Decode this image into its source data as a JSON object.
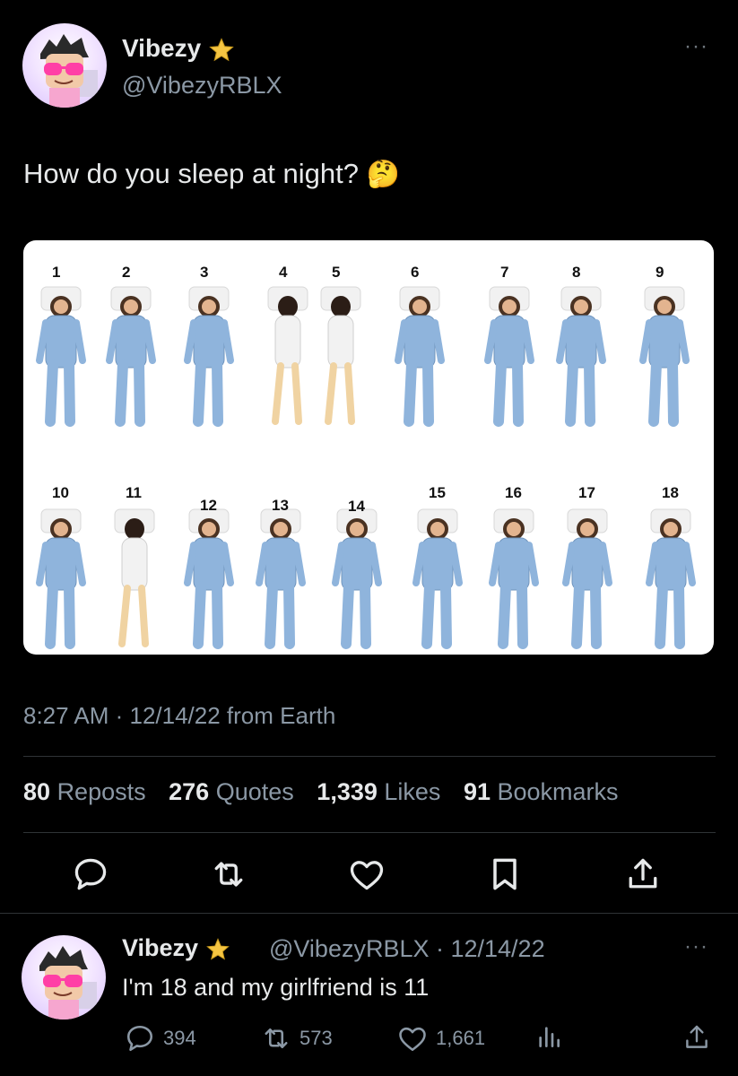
{
  "tweet": {
    "author_name": "Vibezy",
    "author_handle": "@VibezyRBLX",
    "more_label": "···",
    "text": "How do you sleep at night?",
    "emoji": "🤔",
    "timestamp": "8:27 AM · 12/14/22 from Earth",
    "stats": {
      "reposts_count": "80",
      "reposts_label": "Reposts",
      "quotes_count": "276",
      "quotes_label": "Quotes",
      "likes_count": "1,339",
      "likes_label": "Likes",
      "bookmarks_count": "91",
      "bookmarks_label": "Bookmarks"
    },
    "image": {
      "row1_labels": [
        "1",
        "2",
        "3",
        "4",
        "5",
        "6",
        "7",
        "8",
        "9"
      ],
      "row2_labels": [
        "10",
        "11",
        "12",
        "13",
        "14",
        "15",
        "16",
        "17",
        "18"
      ]
    }
  },
  "reply": {
    "author_name": "Vibezy",
    "meta": "@VibezyRBLX · 12/14/22",
    "more_label": "···",
    "text": "I'm 18 and my girlfriend is 11",
    "replies": "394",
    "reposts": "573",
    "likes": "1,661"
  },
  "colors": {
    "background": "#000000",
    "text": "#e7e9ea",
    "secondary": "#8b98a5",
    "divider": "#2f3336",
    "verified_star": "#f5c542",
    "pajama_blue": "#8fb4dc"
  },
  "icons": [
    "reply-icon",
    "repost-icon",
    "like-icon",
    "bookmark-icon",
    "share-icon",
    "views-icon",
    "star-badge-icon",
    "more-icon"
  ]
}
